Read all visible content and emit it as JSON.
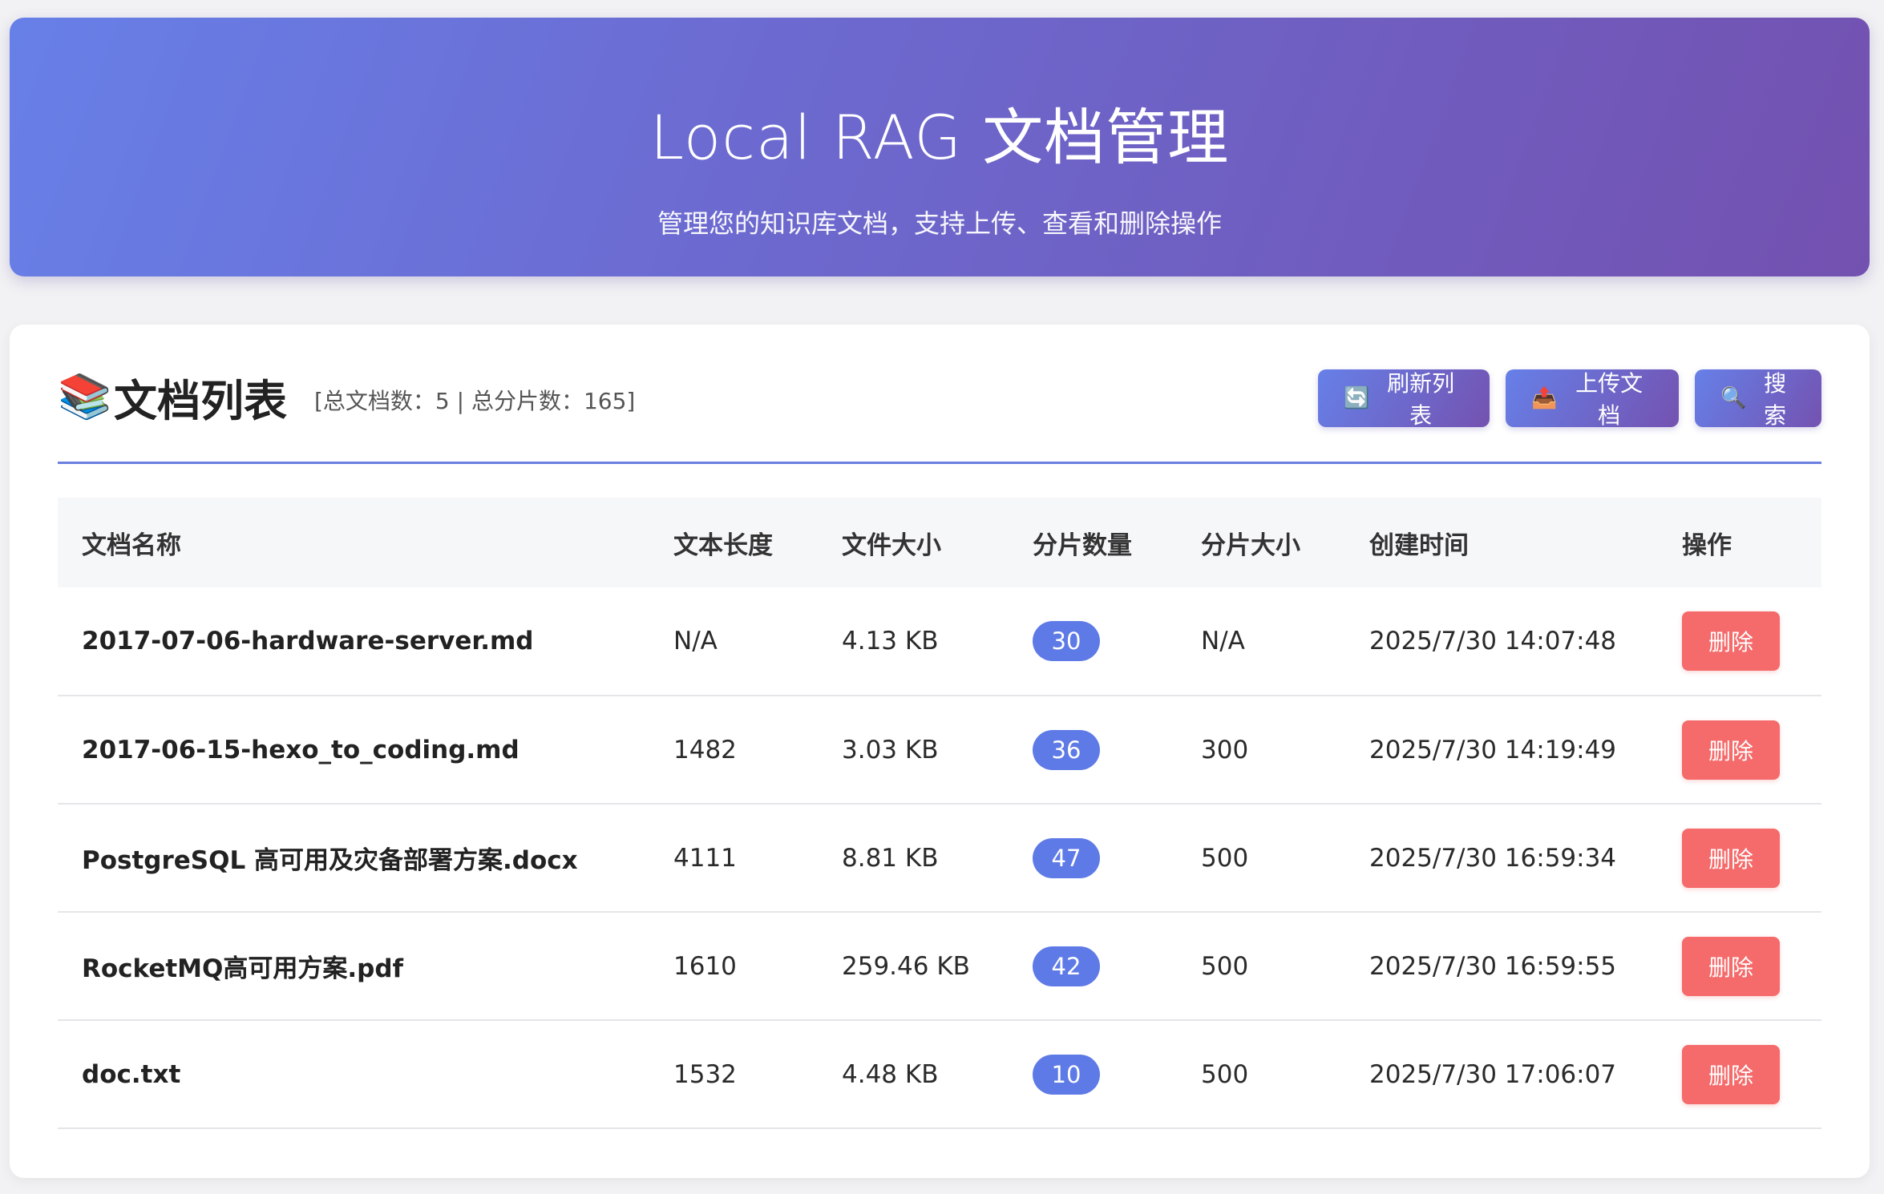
{
  "header": {
    "title": "Local RAG 文档管理",
    "subtitle": "管理您的知识库文档，支持上传、查看和删除操作"
  },
  "list": {
    "icon": "books-icon",
    "title": "文档列表",
    "stats": "[总文档数：5 | 总分片数：165]",
    "buttons": {
      "refresh": "刷新列表",
      "upload": "上传文档",
      "search": "搜索"
    }
  },
  "table": {
    "headers": [
      "文档名称",
      "文本长度",
      "文件大小",
      "分片数量",
      "分片大小",
      "创建时间",
      "操作"
    ],
    "rows": [
      {
        "name": "2017-07-06-hardware-server.md",
        "text_length": "N/A",
        "file_size": "4.13 KB",
        "chunks": "30",
        "chunk_size": "N/A",
        "created": "2025/7/30 14:07:48",
        "action": "删除"
      },
      {
        "name": "2017-06-15-hexo_to_coding.md",
        "text_length": "1482",
        "file_size": "3.03 KB",
        "chunks": "36",
        "chunk_size": "300",
        "created": "2025/7/30 14:19:49",
        "action": "删除"
      },
      {
        "name": "PostgreSQL 高可用及灾备部署方案.docx",
        "text_length": "4111",
        "file_size": "8.81 KB",
        "chunks": "47",
        "chunk_size": "500",
        "created": "2025/7/30 16:59:34",
        "action": "删除"
      },
      {
        "name": "RocketMQ高可用方案.pdf",
        "text_length": "1610",
        "file_size": "259.46 KB",
        "chunks": "42",
        "chunk_size": "500",
        "created": "2025/7/30 16:59:55",
        "action": "删除"
      },
      {
        "name": "doc.txt",
        "text_length": "1532",
        "file_size": "4.48 KB",
        "chunks": "10",
        "chunk_size": "500",
        "created": "2025/7/30 17:06:07",
        "action": "删除"
      }
    ]
  },
  "colors": {
    "header_gradient_start": "#6780e8",
    "header_gradient_end": "#7351b0",
    "chunk_badge": "#5e7ae6",
    "delete_button": "#f56a6a"
  }
}
